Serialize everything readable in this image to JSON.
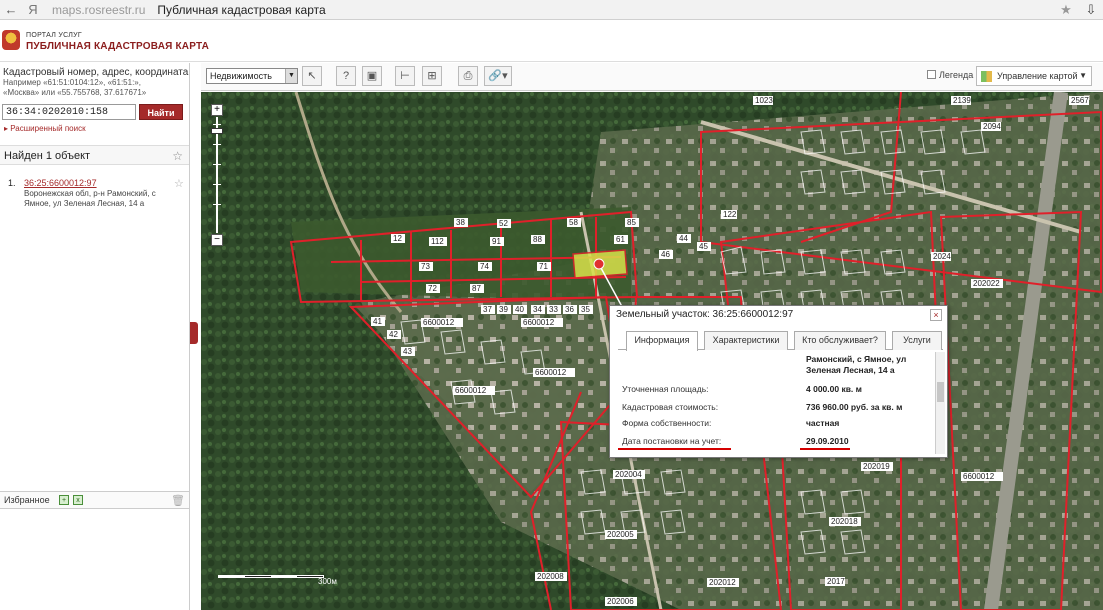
{
  "browser": {
    "back_icon": "back-arrow-icon",
    "ya": "Я",
    "domain": "maps.rosreestr.ru",
    "title": "Публичная кадастровая карта"
  },
  "header": {
    "portal": "ПОРТАЛ УСЛУГ",
    "brand": "ПУБЛИЧНАЯ КАДАСТРОВАЯ КАРТА"
  },
  "search": {
    "label": "Кадастровый номер, адрес, координата",
    "hint": "Например «61:51:0104:12», «61:51:»,\n«Москва» или «55.755768, 37.617671»",
    "value": "36:34:0202010:158",
    "button": "Найти",
    "advanced": "▸ Расширенный поиск"
  },
  "results": {
    "header": "Найден 1 объект",
    "items": [
      {
        "num": "1.",
        "link": "36:25:6600012:97",
        "address": "Воронежская обл, р-н Рамонский, с Ямное, ул Зеленая Лесная, 14 а"
      }
    ]
  },
  "bookmarks": {
    "label": "Избранное"
  },
  "toolbar": {
    "select_value": "Недвижимость",
    "legend": "Легенда",
    "manage": "Управление картой"
  },
  "map": {
    "labels": [
      "1023",
      "2139",
      "2567",
      "2094",
      "202022",
      "2024",
      "2017",
      "202018",
      "202005",
      "202012",
      "202006",
      "202008",
      "202004",
      "202019",
      "6600012",
      "6600012",
      "6600012",
      "6600012",
      "6600012",
      "122",
      "88",
      "61",
      "73",
      "71",
      "72",
      "74",
      "38",
      "112",
      "12",
      "87",
      "91",
      "52",
      "58",
      "85",
      "34",
      "33",
      "36",
      "35",
      "37",
      "39",
      "40",
      "41",
      "42",
      "43",
      "44",
      "45",
      "46"
    ],
    "scale_label": "300м"
  },
  "popup": {
    "title": "Земельный участок: 36:25:6600012:97",
    "tabs": [
      "Информация",
      "Характеристики",
      "Кто обслуживает?",
      "Услуги"
    ],
    "address": "Рамонский, с Ямное, ул\nЗеленая Лесная, 14 а",
    "rows": [
      {
        "key": "Уточненная площадь:",
        "value": "4 000.00 кв. м"
      },
      {
        "key": "Кадастровая стоимость:",
        "value": "736 960.00 руб. за кв. м"
      },
      {
        "key": "Форма собственности:",
        "value": "частная"
      },
      {
        "key": "Дата постановки на учет:",
        "value": "29.09.2010"
      }
    ]
  },
  "colors": {
    "accent": "#a52a2a",
    "parcel": "#e0202a",
    "highlight": "#d8e24a"
  }
}
